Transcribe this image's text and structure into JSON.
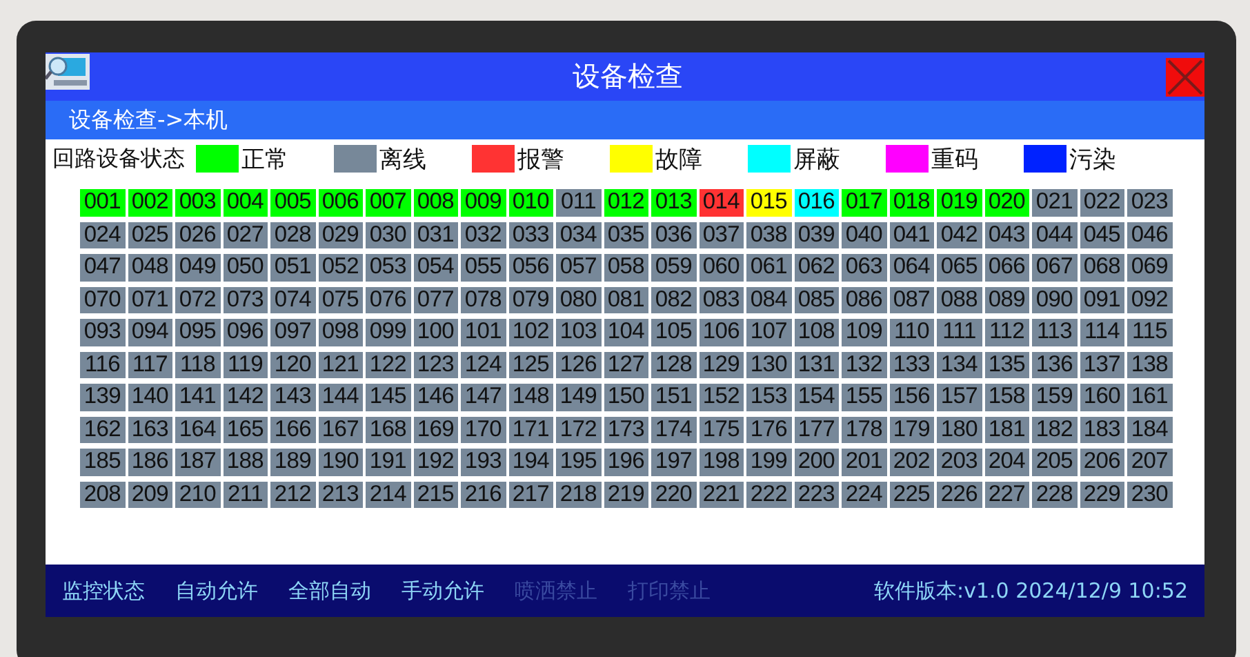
{
  "window": {
    "title": "设备检查"
  },
  "breadcrumb": "设备检查->本机",
  "legend": {
    "label": "回路设备状态",
    "items": [
      {
        "label": "正常",
        "color": "#00ff00"
      },
      {
        "label": "离线",
        "color": "#778899"
      },
      {
        "label": "报警",
        "color": "#ff3333"
      },
      {
        "label": "故障",
        "color": "#ffff00"
      },
      {
        "label": "屏蔽",
        "color": "#00ffff"
      },
      {
        "label": "重码",
        "color": "#ff00ff"
      },
      {
        "label": "污染",
        "color": "#0022ff"
      }
    ]
  },
  "devices": [
    {
      "label": "001",
      "color": "#00ff00"
    },
    {
      "label": "002",
      "color": "#00ff00"
    },
    {
      "label": "003",
      "color": "#00ff00"
    },
    {
      "label": "004",
      "color": "#00ff00"
    },
    {
      "label": "005",
      "color": "#00ff00"
    },
    {
      "label": "006",
      "color": "#00ff00"
    },
    {
      "label": "007",
      "color": "#00ff00"
    },
    {
      "label": "008",
      "color": "#00ff00"
    },
    {
      "label": "009",
      "color": "#00ff00"
    },
    {
      "label": "010",
      "color": "#00ff00"
    },
    {
      "label": "011",
      "color": "#778899"
    },
    {
      "label": "012",
      "color": "#00ff00"
    },
    {
      "label": "013",
      "color": "#00ff00"
    },
    {
      "label": "014",
      "color": "#ff3333"
    },
    {
      "label": "015",
      "color": "#ffff00"
    },
    {
      "label": "016",
      "color": "#00ffff"
    },
    {
      "label": "017",
      "color": "#00ff00"
    },
    {
      "label": "018",
      "color": "#00ff00"
    },
    {
      "label": "019",
      "color": "#00ff00"
    },
    {
      "label": "020",
      "color": "#00ff00"
    },
    {
      "label": "021",
      "color": "#778899"
    },
    {
      "label": "022",
      "color": "#778899"
    },
    {
      "label": "023",
      "color": "#778899"
    },
    {
      "label": "024",
      "color": "#778899"
    },
    {
      "label": "025",
      "color": "#778899"
    },
    {
      "label": "026",
      "color": "#778899"
    },
    {
      "label": "027",
      "color": "#778899"
    },
    {
      "label": "028",
      "color": "#778899"
    },
    {
      "label": "029",
      "color": "#778899"
    },
    {
      "label": "030",
      "color": "#778899"
    },
    {
      "label": "031",
      "color": "#778899"
    },
    {
      "label": "032",
      "color": "#778899"
    },
    {
      "label": "033",
      "color": "#778899"
    },
    {
      "label": "034",
      "color": "#778899"
    },
    {
      "label": "035",
      "color": "#778899"
    },
    {
      "label": "036",
      "color": "#778899"
    },
    {
      "label": "037",
      "color": "#778899"
    },
    {
      "label": "038",
      "color": "#778899"
    },
    {
      "label": "039",
      "color": "#778899"
    },
    {
      "label": "040",
      "color": "#778899"
    },
    {
      "label": "041",
      "color": "#778899"
    },
    {
      "label": "042",
      "color": "#778899"
    },
    {
      "label": "043",
      "color": "#778899"
    },
    {
      "label": "044",
      "color": "#778899"
    },
    {
      "label": "045",
      "color": "#778899"
    },
    {
      "label": "046",
      "color": "#778899"
    },
    {
      "label": "047",
      "color": "#778899"
    },
    {
      "label": "048",
      "color": "#778899"
    },
    {
      "label": "049",
      "color": "#778899"
    },
    {
      "label": "050",
      "color": "#778899"
    },
    {
      "label": "051",
      "color": "#778899"
    },
    {
      "label": "052",
      "color": "#778899"
    },
    {
      "label": "053",
      "color": "#778899"
    },
    {
      "label": "054",
      "color": "#778899"
    },
    {
      "label": "055",
      "color": "#778899"
    },
    {
      "label": "056",
      "color": "#778899"
    },
    {
      "label": "057",
      "color": "#778899"
    },
    {
      "label": "058",
      "color": "#778899"
    },
    {
      "label": "059",
      "color": "#778899"
    },
    {
      "label": "060",
      "color": "#778899"
    },
    {
      "label": "061",
      "color": "#778899"
    },
    {
      "label": "062",
      "color": "#778899"
    },
    {
      "label": "063",
      "color": "#778899"
    },
    {
      "label": "064",
      "color": "#778899"
    },
    {
      "label": "065",
      "color": "#778899"
    },
    {
      "label": "066",
      "color": "#778899"
    },
    {
      "label": "067",
      "color": "#778899"
    },
    {
      "label": "068",
      "color": "#778899"
    },
    {
      "label": "069",
      "color": "#778899"
    },
    {
      "label": "070",
      "color": "#778899"
    },
    {
      "label": "071",
      "color": "#778899"
    },
    {
      "label": "072",
      "color": "#778899"
    },
    {
      "label": "073",
      "color": "#778899"
    },
    {
      "label": "074",
      "color": "#778899"
    },
    {
      "label": "075",
      "color": "#778899"
    },
    {
      "label": "076",
      "color": "#778899"
    },
    {
      "label": "077",
      "color": "#778899"
    },
    {
      "label": "078",
      "color": "#778899"
    },
    {
      "label": "079",
      "color": "#778899"
    },
    {
      "label": "080",
      "color": "#778899"
    },
    {
      "label": "081",
      "color": "#778899"
    },
    {
      "label": "082",
      "color": "#778899"
    },
    {
      "label": "083",
      "color": "#778899"
    },
    {
      "label": "084",
      "color": "#778899"
    },
    {
      "label": "085",
      "color": "#778899"
    },
    {
      "label": "086",
      "color": "#778899"
    },
    {
      "label": "087",
      "color": "#778899"
    },
    {
      "label": "088",
      "color": "#778899"
    },
    {
      "label": "089",
      "color": "#778899"
    },
    {
      "label": "090",
      "color": "#778899"
    },
    {
      "label": "091",
      "color": "#778899"
    },
    {
      "label": "092",
      "color": "#778899"
    },
    {
      "label": "093",
      "color": "#778899"
    },
    {
      "label": "094",
      "color": "#778899"
    },
    {
      "label": "095",
      "color": "#778899"
    },
    {
      "label": "096",
      "color": "#778899"
    },
    {
      "label": "097",
      "color": "#778899"
    },
    {
      "label": "098",
      "color": "#778899"
    },
    {
      "label": "099",
      "color": "#778899"
    },
    {
      "label": "100",
      "color": "#778899"
    },
    {
      "label": "101",
      "color": "#778899"
    },
    {
      "label": "102",
      "color": "#778899"
    },
    {
      "label": "103",
      "color": "#778899"
    },
    {
      "label": "104",
      "color": "#778899"
    },
    {
      "label": "105",
      "color": "#778899"
    },
    {
      "label": "106",
      "color": "#778899"
    },
    {
      "label": "107",
      "color": "#778899"
    },
    {
      "label": "108",
      "color": "#778899"
    },
    {
      "label": "109",
      "color": "#778899"
    },
    {
      "label": "110",
      "color": "#778899"
    },
    {
      "label": "111",
      "color": "#778899"
    },
    {
      "label": "112",
      "color": "#778899"
    },
    {
      "label": "113",
      "color": "#778899"
    },
    {
      "label": "114",
      "color": "#778899"
    },
    {
      "label": "115",
      "color": "#778899"
    },
    {
      "label": "116",
      "color": "#778899"
    },
    {
      "label": "117",
      "color": "#778899"
    },
    {
      "label": "118",
      "color": "#778899"
    },
    {
      "label": "119",
      "color": "#778899"
    },
    {
      "label": "120",
      "color": "#778899"
    },
    {
      "label": "121",
      "color": "#778899"
    },
    {
      "label": "122",
      "color": "#778899"
    },
    {
      "label": "123",
      "color": "#778899"
    },
    {
      "label": "124",
      "color": "#778899"
    },
    {
      "label": "125",
      "color": "#778899"
    },
    {
      "label": "126",
      "color": "#778899"
    },
    {
      "label": "127",
      "color": "#778899"
    },
    {
      "label": "128",
      "color": "#778899"
    },
    {
      "label": "129",
      "color": "#778899"
    },
    {
      "label": "130",
      "color": "#778899"
    },
    {
      "label": "131",
      "color": "#778899"
    },
    {
      "label": "132",
      "color": "#778899"
    },
    {
      "label": "133",
      "color": "#778899"
    },
    {
      "label": "134",
      "color": "#778899"
    },
    {
      "label": "135",
      "color": "#778899"
    },
    {
      "label": "136",
      "color": "#778899"
    },
    {
      "label": "137",
      "color": "#778899"
    },
    {
      "label": "138",
      "color": "#778899"
    },
    {
      "label": "139",
      "color": "#778899"
    },
    {
      "label": "140",
      "color": "#778899"
    },
    {
      "label": "141",
      "color": "#778899"
    },
    {
      "label": "142",
      "color": "#778899"
    },
    {
      "label": "143",
      "color": "#778899"
    },
    {
      "label": "144",
      "color": "#778899"
    },
    {
      "label": "145",
      "color": "#778899"
    },
    {
      "label": "146",
      "color": "#778899"
    },
    {
      "label": "147",
      "color": "#778899"
    },
    {
      "label": "148",
      "color": "#778899"
    },
    {
      "label": "149",
      "color": "#778899"
    },
    {
      "label": "150",
      "color": "#778899"
    },
    {
      "label": "151",
      "color": "#778899"
    },
    {
      "label": "152",
      "color": "#778899"
    },
    {
      "label": "153",
      "color": "#778899"
    },
    {
      "label": "154",
      "color": "#778899"
    },
    {
      "label": "155",
      "color": "#778899"
    },
    {
      "label": "156",
      "color": "#778899"
    },
    {
      "label": "157",
      "color": "#778899"
    },
    {
      "label": "158",
      "color": "#778899"
    },
    {
      "label": "159",
      "color": "#778899"
    },
    {
      "label": "160",
      "color": "#778899"
    },
    {
      "label": "161",
      "color": "#778899"
    },
    {
      "label": "162",
      "color": "#778899"
    },
    {
      "label": "163",
      "color": "#778899"
    },
    {
      "label": "164",
      "color": "#778899"
    },
    {
      "label": "165",
      "color": "#778899"
    },
    {
      "label": "166",
      "color": "#778899"
    },
    {
      "label": "167",
      "color": "#778899"
    },
    {
      "label": "168",
      "color": "#778899"
    },
    {
      "label": "169",
      "color": "#778899"
    },
    {
      "label": "170",
      "color": "#778899"
    },
    {
      "label": "171",
      "color": "#778899"
    },
    {
      "label": "172",
      "color": "#778899"
    },
    {
      "label": "173",
      "color": "#778899"
    },
    {
      "label": "174",
      "color": "#778899"
    },
    {
      "label": "175",
      "color": "#778899"
    },
    {
      "label": "176",
      "color": "#778899"
    },
    {
      "label": "177",
      "color": "#778899"
    },
    {
      "label": "178",
      "color": "#778899"
    },
    {
      "label": "179",
      "color": "#778899"
    },
    {
      "label": "180",
      "color": "#778899"
    },
    {
      "label": "181",
      "color": "#778899"
    },
    {
      "label": "182",
      "color": "#778899"
    },
    {
      "label": "183",
      "color": "#778899"
    },
    {
      "label": "184",
      "color": "#778899"
    },
    {
      "label": "185",
      "color": "#778899"
    },
    {
      "label": "186",
      "color": "#778899"
    },
    {
      "label": "187",
      "color": "#778899"
    },
    {
      "label": "188",
      "color": "#778899"
    },
    {
      "label": "189",
      "color": "#778899"
    },
    {
      "label": "190",
      "color": "#778899"
    },
    {
      "label": "191",
      "color": "#778899"
    },
    {
      "label": "192",
      "color": "#778899"
    },
    {
      "label": "193",
      "color": "#778899"
    },
    {
      "label": "194",
      "color": "#778899"
    },
    {
      "label": "195",
      "color": "#778899"
    },
    {
      "label": "196",
      "color": "#778899"
    },
    {
      "label": "197",
      "color": "#778899"
    },
    {
      "label": "198",
      "color": "#778899"
    },
    {
      "label": "199",
      "color": "#778899"
    },
    {
      "label": "200",
      "color": "#778899"
    },
    {
      "label": "201",
      "color": "#778899"
    },
    {
      "label": "202",
      "color": "#778899"
    },
    {
      "label": "203",
      "color": "#778899"
    },
    {
      "label": "204",
      "color": "#778899"
    },
    {
      "label": "205",
      "color": "#778899"
    },
    {
      "label": "206",
      "color": "#778899"
    },
    {
      "label": "207",
      "color": "#778899"
    },
    {
      "label": "208",
      "color": "#778899"
    },
    {
      "label": "209",
      "color": "#778899"
    },
    {
      "label": "210",
      "color": "#778899"
    },
    {
      "label": "211",
      "color": "#778899"
    },
    {
      "label": "212",
      "color": "#778899"
    },
    {
      "label": "213",
      "color": "#778899"
    },
    {
      "label": "214",
      "color": "#778899"
    },
    {
      "label": "215",
      "color": "#778899"
    },
    {
      "label": "216",
      "color": "#778899"
    },
    {
      "label": "217",
      "color": "#778899"
    },
    {
      "label": "218",
      "color": "#778899"
    },
    {
      "label": "219",
      "color": "#778899"
    },
    {
      "label": "220",
      "color": "#778899"
    },
    {
      "label": "221",
      "color": "#778899"
    },
    {
      "label": "222",
      "color": "#778899"
    },
    {
      "label": "223",
      "color": "#778899"
    },
    {
      "label": "224",
      "color": "#778899"
    },
    {
      "label": "225",
      "color": "#778899"
    },
    {
      "label": "226",
      "color": "#778899"
    },
    {
      "label": "227",
      "color": "#778899"
    },
    {
      "label": "228",
      "color": "#778899"
    },
    {
      "label": "229",
      "color": "#778899"
    },
    {
      "label": "230",
      "color": "#778899"
    }
  ],
  "footer": {
    "buttons": [
      {
        "label": "监控状态",
        "disabled": false
      },
      {
        "label": "自动允许",
        "disabled": false
      },
      {
        "label": "全部自动",
        "disabled": false
      },
      {
        "label": "手动允许",
        "disabled": false
      },
      {
        "label": "喷洒禁止",
        "disabled": true
      },
      {
        "label": "打印禁止",
        "disabled": true
      }
    ],
    "version": "软件版本:v1.0 2024/12/9 10:52"
  }
}
